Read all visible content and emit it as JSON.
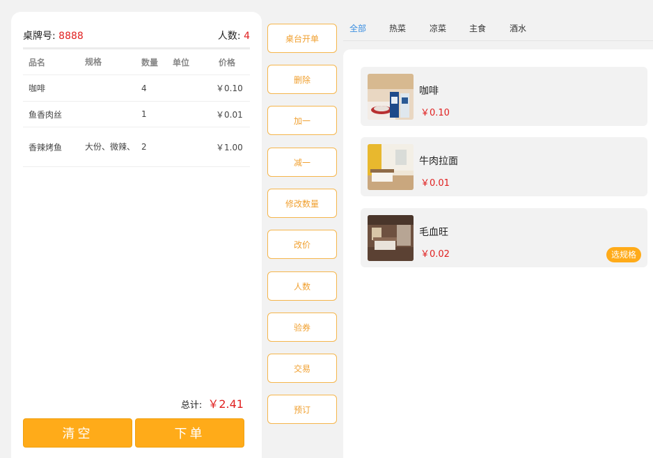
{
  "order": {
    "table_label": "桌牌号:",
    "table_value": "8888",
    "people_label": "人数:",
    "people_value": "4",
    "columns": {
      "name": "品名",
      "spec": "规格",
      "qty": "数量",
      "unit": "单位",
      "price": "价格"
    },
    "rows": [
      {
        "name": "咖啡",
        "spec": "",
        "qty": "4",
        "unit": "",
        "price": "￥0.10"
      },
      {
        "name": "鱼香肉丝",
        "spec": "",
        "qty": "1",
        "unit": "",
        "price": "￥0.01"
      },
      {
        "name": "香辣烤鱼",
        "spec": "大份、微辣、",
        "qty": "2",
        "unit": "",
        "price": "￥1.00"
      }
    ],
    "total_label": "总计:",
    "total_value": "￥2.41",
    "clear_label": "清空",
    "submit_label": "下单"
  },
  "actions": [
    "桌台开单",
    "删除",
    "加一",
    "减一",
    "修改数量",
    "改价",
    "人数",
    "验券",
    "交易",
    "预订"
  ],
  "tabs": [
    {
      "label": "全部",
      "active": true
    },
    {
      "label": "热菜",
      "active": false
    },
    {
      "label": "凉菜",
      "active": false
    },
    {
      "label": "主食",
      "active": false
    },
    {
      "label": "酒水",
      "active": false
    }
  ],
  "dishes": [
    {
      "name": "咖啡",
      "price": "￥0.10",
      "spec_label": "",
      "image": "coffee-photo"
    },
    {
      "name": "牛肉拉面",
      "price": "￥0.01",
      "spec_label": "",
      "image": "room-photo-yellow"
    },
    {
      "name": "毛血旺",
      "price": "￥0.02",
      "spec_label": "选规格",
      "image": "room-photo-brown"
    }
  ],
  "colors": {
    "accent": "#ffab19",
    "price": "#e02020",
    "active_tab": "#3b8fe0"
  }
}
